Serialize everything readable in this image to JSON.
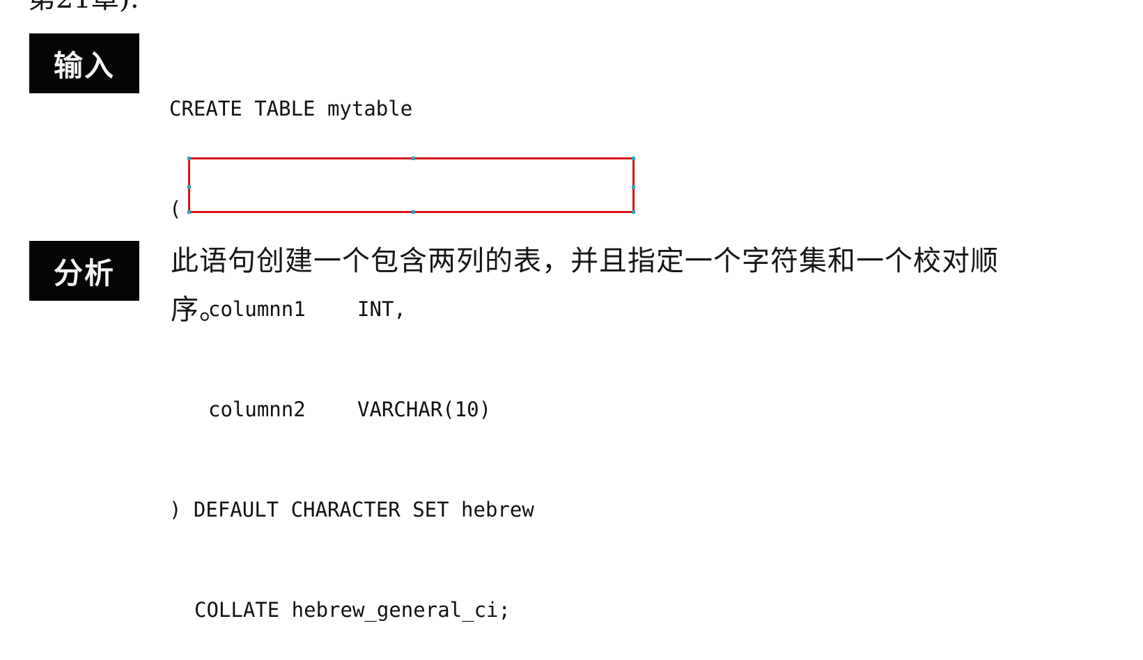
{
  "header_fragment": "第21章):",
  "input_tag": "输入",
  "analysis_tag": "分析",
  "code": {
    "line1": "CREATE TABLE mytable",
    "line2": "(",
    "col1_name": "columnn1",
    "col1_type": "INT,",
    "col2_name": "columnn2",
    "col2_type": "VARCHAR(10)",
    "line5_prefix": ") ",
    "line5_rest": "DEFAULT CHARACTER SET hebrew",
    "line6": "COLLATE hebrew_general_ci;"
  },
  "highlight": {
    "color": "#d9151b",
    "handle_color": "#3aa0b0"
  },
  "analysis": {
    "text": "此语句创建一个包含两列的表，并且指定一个字符集和一个校对顺序。"
  }
}
